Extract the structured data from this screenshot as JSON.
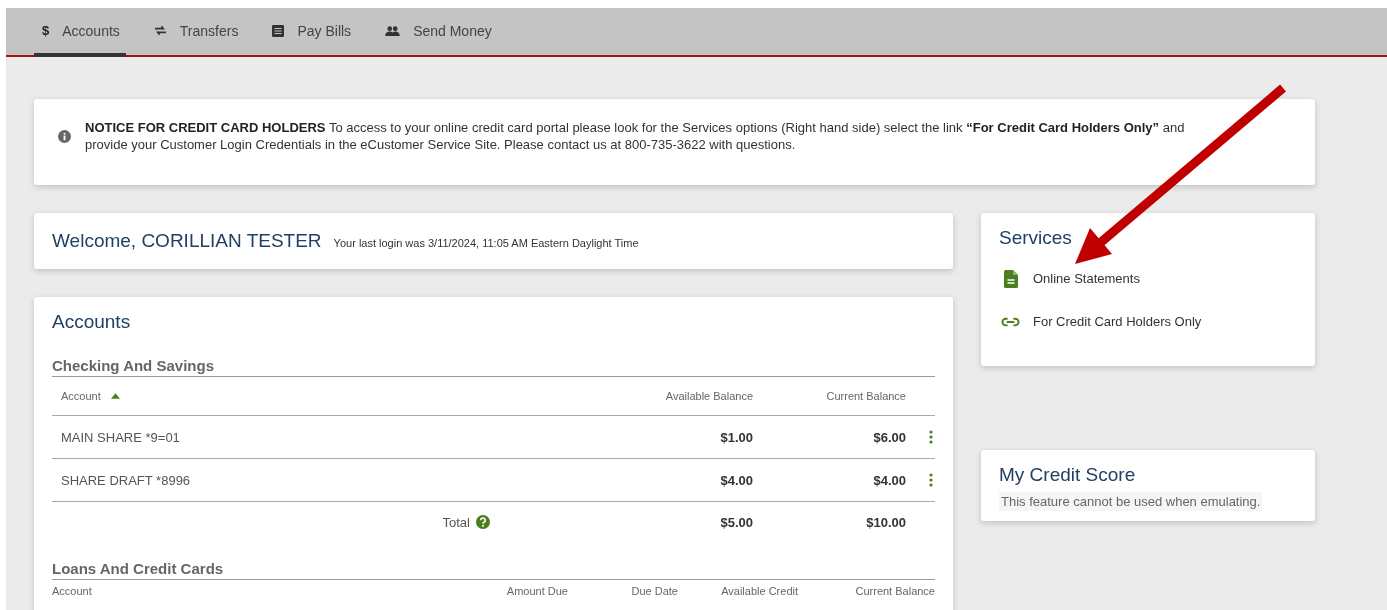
{
  "tabs": [
    {
      "label": "Accounts",
      "kind": "dollar",
      "glyph": "$",
      "selected": true
    },
    {
      "label": "Transfers",
      "kind": "transfer",
      "selected": false
    },
    {
      "label": "Pay Bills",
      "kind": "bill",
      "selected": false
    },
    {
      "label": "Send Money",
      "kind": "people",
      "selected": false
    }
  ],
  "notice": {
    "text": "**NOTICE FOR CREDIT CARD HOLDERS** To access to your online credit card portal please look for the Services options (Right hand side) select the link **“For Credit Card Holders Only”** and provide your Customer Login Credentials in the eCustomer Service Site. Please contact us at 800-735-3622 with questions."
  },
  "welcome": {
    "title": "Welcome, CORILLIAN TESTER",
    "last_login": "Your last login was 3/11/2024, 11:05 AM Eastern Daylight Time"
  },
  "accounts": {
    "title": "Accounts",
    "checking": {
      "heading": "Checking And Savings",
      "columns": [
        {
          "label": "Account",
          "sort_ascending": true
        },
        {
          "label": "Available Balance"
        },
        {
          "label": "Current Balance"
        }
      ],
      "rows": [
        {
          "account": "MAIN SHARE  *9=01",
          "available": "$1.00",
          "current": "$6.00"
        },
        {
          "account": "SHARE DRAFT  *8996",
          "available": "$4.00",
          "current": "$4.00"
        }
      ],
      "total": {
        "label": "Total",
        "available": "$5.00",
        "current": "$10.00"
      }
    },
    "loans": {
      "heading": "Loans And Credit Cards",
      "columns": [
        "Account",
        "Amount Due",
        "Due Date",
        "Available Credit",
        "Current Balance"
      ]
    }
  },
  "services": {
    "title": "Services",
    "items": [
      {
        "label": "Online Statements",
        "kind": "document"
      },
      {
        "label": "For Credit Card Holders Only",
        "kind": "link"
      }
    ]
  },
  "credit_score": {
    "title": "My Credit Score",
    "message": "This feature cannot be used when emulating."
  },
  "annotations": [
    {
      "kind": "arrow",
      "color": "#c00000"
    }
  ]
}
